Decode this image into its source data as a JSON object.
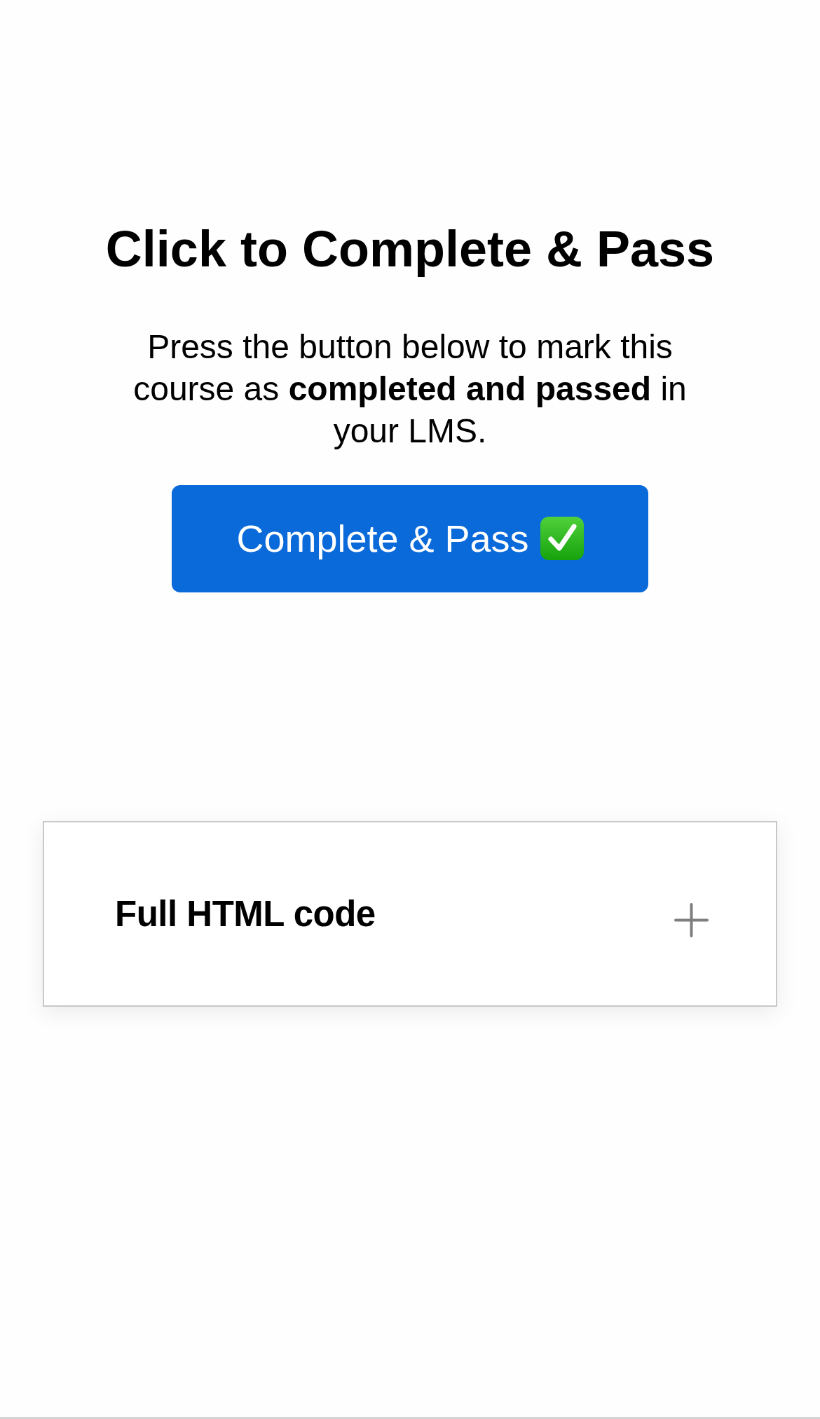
{
  "heading": "Click to Complete & Pass",
  "intro": "Press the button below to mark this course as **completed and passed** in your LMS.",
  "complete_button": {
    "label": "Complete & Pass"
  },
  "accordion": [
    {
      "title": "Full HTML code",
      "expanded": false
    }
  ]
}
